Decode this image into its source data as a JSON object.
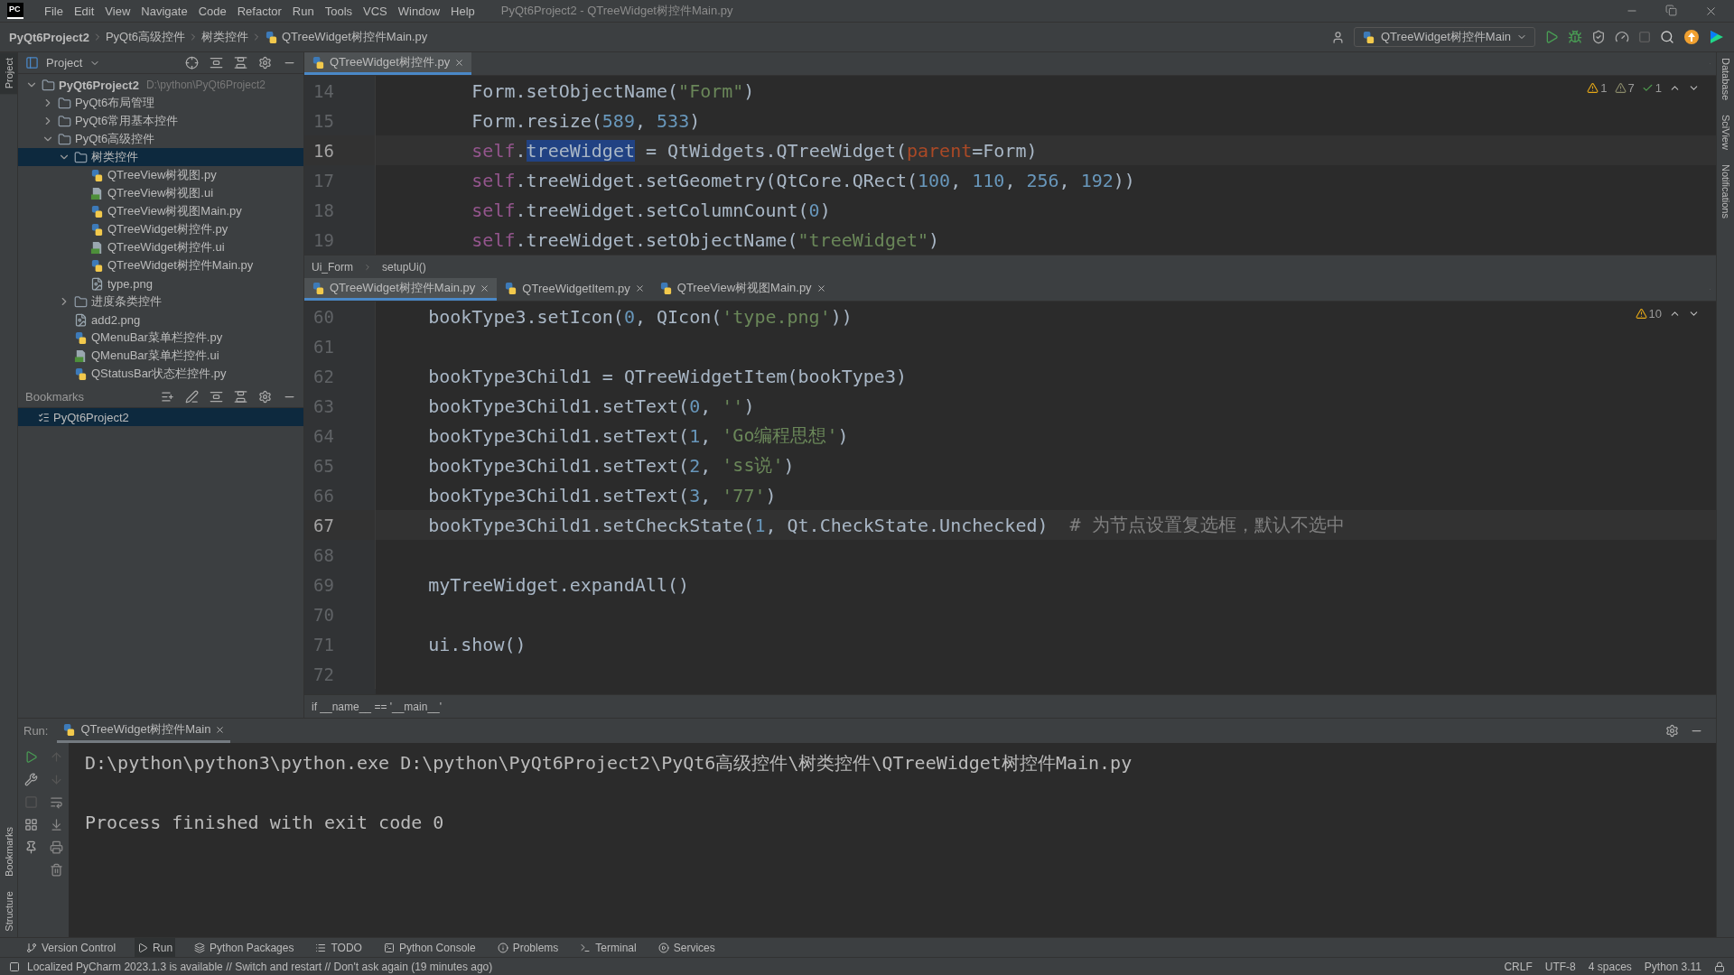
{
  "menu_bar": {
    "logo": "PC",
    "items": [
      "File",
      "Edit",
      "View",
      "Navigate",
      "Code",
      "Refactor",
      "Run",
      "Tools",
      "VCS",
      "Window",
      "Help"
    ],
    "title": "PyQt6Project2 - QTreeWidget树控件Main.py"
  },
  "nav_bar": {
    "breadcrumbs": [
      {
        "label": "PyQt6Project2",
        "kind": "project"
      },
      {
        "label": "PyQt6高级控件",
        "kind": "folder"
      },
      {
        "label": "树类控件",
        "kind": "folder"
      },
      {
        "label": "QTreeWidget树控件Main.py",
        "kind": "python"
      }
    ],
    "run_config": "QTreeWidget树控件Main"
  },
  "left_strip": {
    "top": [
      "Project"
    ],
    "bottom": [
      "Bookmarks",
      "Structure"
    ]
  },
  "right_strip": [
    "Database",
    "SciView",
    "Notifications"
  ],
  "project_panel": {
    "title": "Project",
    "tree": [
      {
        "label": "PyQt6Project2",
        "detail": "D:\\python\\PyQt6Project2",
        "kind": "folder",
        "expanded": true,
        "selected": false,
        "children": [
          {
            "label": "PyQt6布局管理",
            "kind": "folder",
            "expanded": false,
            "selected": false
          },
          {
            "label": "PyQt6常用基本控件",
            "kind": "folder",
            "expanded": false,
            "selected": false
          },
          {
            "label": "PyQt6高级控件",
            "kind": "folder",
            "expanded": true,
            "selected": false,
            "children": [
              {
                "label": "树类控件",
                "kind": "folder",
                "expanded": true,
                "selected": true,
                "children": [
                  {
                    "label": "QTreeView树视图.py",
                    "kind": "python",
                    "selected": false
                  },
                  {
                    "label": "QTreeView树视图.ui",
                    "kind": "ui",
                    "selected": false
                  },
                  {
                    "label": "QTreeView树视图Main.py",
                    "kind": "python",
                    "selected": false
                  },
                  {
                    "label": "QTreeWidget树控件.py",
                    "kind": "python",
                    "selected": false
                  },
                  {
                    "label": "QTreeWidget树控件.ui",
                    "kind": "ui",
                    "selected": false
                  },
                  {
                    "label": "QTreeWidget树控件Main.py",
                    "kind": "python",
                    "selected": false
                  },
                  {
                    "label": "type.png",
                    "kind": "image",
                    "selected": false
                  }
                ]
              },
              {
                "label": "进度条类控件",
                "kind": "folder",
                "expanded": false,
                "selected": false
              },
              {
                "label": "add2.png",
                "kind": "image",
                "selected": false
              },
              {
                "label": "QMenuBar菜单栏控件.py",
                "kind": "python",
                "selected": false
              },
              {
                "label": "QMenuBar菜单栏控件.ui",
                "kind": "ui",
                "selected": false
              },
              {
                "label": "QStatusBar状态栏控件.py",
                "kind": "python",
                "selected": false
              }
            ]
          }
        ]
      }
    ]
  },
  "bookmarks_panel": {
    "title": "Bookmarks",
    "items": [
      {
        "label": "PyQt6Project2",
        "selected": true
      }
    ]
  },
  "top_editor": {
    "tabs": [
      {
        "label": "QTreeWidget树控件.py",
        "selected": true
      }
    ],
    "inspections": [
      {
        "kind": "warning",
        "count": "1"
      },
      {
        "kind": "weak_warning",
        "count": "7"
      },
      {
        "kind": "typo",
        "count": "1"
      }
    ],
    "lines": [
      {
        "number": "14",
        "current": false,
        "tokens": [
          {
            "text": "        Form.setObjectName(",
            "kind": "plain"
          },
          {
            "text": "\"Form\"",
            "kind": "string"
          },
          {
            "text": ")",
            "kind": "plain"
          }
        ]
      },
      {
        "number": "15",
        "current": false,
        "tokens": [
          {
            "text": "        Form.resize(",
            "kind": "plain"
          },
          {
            "text": "589",
            "kind": "number"
          },
          {
            "text": ", ",
            "kind": "plain"
          },
          {
            "text": "533",
            "kind": "number"
          },
          {
            "text": ")",
            "kind": "plain"
          }
        ]
      },
      {
        "number": "16",
        "current": true,
        "tokens": [
          {
            "text": "        self",
            "kind": "self"
          },
          {
            "text": ".",
            "kind": "plain"
          },
          {
            "text": "treeWidget",
            "kind": "highlight"
          },
          {
            "text": " = QtWidgets.QTreeWidget(",
            "kind": "plain"
          },
          {
            "text": "parent",
            "kind": "param"
          },
          {
            "text": "=Form)",
            "kind": "plain"
          }
        ]
      },
      {
        "number": "17",
        "current": false,
        "tokens": [
          {
            "text": "        self",
            "kind": "self"
          },
          {
            "text": ".treeWidget.setGeometry(QtCore.QRect(",
            "kind": "plain"
          },
          {
            "text": "100",
            "kind": "number"
          },
          {
            "text": ", ",
            "kind": "plain"
          },
          {
            "text": "110",
            "kind": "number"
          },
          {
            "text": ", ",
            "kind": "plain"
          },
          {
            "text": "256",
            "kind": "number"
          },
          {
            "text": ", ",
            "kind": "plain"
          },
          {
            "text": "192",
            "kind": "number"
          },
          {
            "text": "))",
            "kind": "plain"
          }
        ]
      },
      {
        "number": "18",
        "current": false,
        "tokens": [
          {
            "text": "        self",
            "kind": "self"
          },
          {
            "text": ".treeWidget.setColumnCount(",
            "kind": "plain"
          },
          {
            "text": "0",
            "kind": "number"
          },
          {
            "text": ")",
            "kind": "plain"
          }
        ]
      },
      {
        "number": "19",
        "current": false,
        "tokens": [
          {
            "text": "        self",
            "kind": "self"
          },
          {
            "text": ".treeWidget.setObjectName(",
            "kind": "plain"
          },
          {
            "text": "\"treeWidget\"",
            "kind": "string"
          },
          {
            "text": ")",
            "kind": "plain"
          }
        ]
      }
    ],
    "breadcrumbs": [
      "Ui_Form",
      "setupUi()"
    ]
  },
  "bottom_editor": {
    "tabs": [
      {
        "label": "QTreeWidget树控件Main.py",
        "selected": true
      },
      {
        "label": "QTreeWidgetItem.py",
        "selected": false
      },
      {
        "label": "QTreeView树视图Main.py",
        "selected": false
      }
    ],
    "inspections": [
      {
        "kind": "warning",
        "count": "10"
      }
    ],
    "lines": [
      {
        "number": "60",
        "current": false,
        "tokens": [
          {
            "text": "    bookType3.setIcon(",
            "kind": "plain"
          },
          {
            "text": "0",
            "kind": "number"
          },
          {
            "text": ", QIcon(",
            "kind": "plain"
          },
          {
            "text": "'type.png'",
            "kind": "string"
          },
          {
            "text": "))",
            "kind": "plain"
          }
        ]
      },
      {
        "number": "61",
        "current": false
      },
      {
        "number": "62",
        "current": false,
        "tokens": [
          {
            "text": "    bookType3Child1 = QTreeWidgetItem(bookType3)",
            "kind": "plain"
          }
        ]
      },
      {
        "number": "63",
        "current": false,
        "tokens": [
          {
            "text": "    bookType3Child1.setText(",
            "kind": "plain"
          },
          {
            "text": "0",
            "kind": "number"
          },
          {
            "text": ", ",
            "kind": "plain"
          },
          {
            "text": "''",
            "kind": "string"
          },
          {
            "text": ")",
            "kind": "plain"
          }
        ]
      },
      {
        "number": "64",
        "current": false,
        "tokens": [
          {
            "text": "    bookType3Child1.setText(",
            "kind": "plain"
          },
          {
            "text": "1",
            "kind": "number"
          },
          {
            "text": ", ",
            "kind": "plain"
          },
          {
            "text": "'Go编程思想'",
            "kind": "string"
          },
          {
            "text": ")",
            "kind": "plain"
          }
        ]
      },
      {
        "number": "65",
        "current": false,
        "tokens": [
          {
            "text": "    bookType3Child1.setText(",
            "kind": "plain"
          },
          {
            "text": "2",
            "kind": "number"
          },
          {
            "text": ", ",
            "kind": "plain"
          },
          {
            "text": "'ss说'",
            "kind": "string"
          },
          {
            "text": ")",
            "kind": "plain"
          }
        ]
      },
      {
        "number": "66",
        "current": false,
        "tokens": [
          {
            "text": "    bookType3Child1.setText(",
            "kind": "plain"
          },
          {
            "text": "3",
            "kind": "number"
          },
          {
            "text": ", ",
            "kind": "plain"
          },
          {
            "text": "'77'",
            "kind": "string"
          },
          {
            "text": ")",
            "kind": "plain"
          }
        ]
      },
      {
        "number": "67",
        "current": true,
        "tokens": [
          {
            "text": "    bookType3Child1.setCheckState(",
            "kind": "plain"
          },
          {
            "text": "1",
            "kind": "number"
          },
          {
            "text": ", Qt.CheckState.Unchecked)  ",
            "kind": "plain"
          },
          {
            "text": "# 为节点设置复选框，默认不选中",
            "kind": "comment"
          }
        ]
      },
      {
        "number": "68",
        "current": false
      },
      {
        "number": "69",
        "current": false,
        "tokens": [
          {
            "text": "    myTreeWidget.expandAll()",
            "kind": "plain"
          }
        ]
      },
      {
        "number": "70",
        "current": false
      },
      {
        "number": "71",
        "current": false,
        "tokens": [
          {
            "text": "    ui.show()",
            "kind": "plain"
          }
        ]
      },
      {
        "number": "72",
        "current": false
      }
    ],
    "breadcrumbs": [
      "if __name__ == '__main__'"
    ]
  },
  "run_panel": {
    "label": "Run:",
    "tabs": [
      {
        "label": "QTreeWidget树控件Main",
        "selected": true
      }
    ],
    "output": [
      "D:\\python\\python3\\python.exe D:\\python\\PyQt6Project2\\PyQt6高级控件\\树类控件\\QTreeWidget树控件Main.py",
      "Process finished with exit code 0"
    ]
  },
  "tool_window_bar": [
    {
      "label": "Version Control",
      "kind": "vcs",
      "selected": false
    },
    {
      "label": "Run",
      "kind": "run",
      "selected": true
    },
    {
      "label": "Python Packages",
      "kind": "packages",
      "selected": false
    },
    {
      "label": "TODO",
      "kind": "todo",
      "selected": false
    },
    {
      "label": "Python Console",
      "kind": "console",
      "selected": false
    },
    {
      "label": "Problems",
      "kind": "problems",
      "selected": false
    },
    {
      "label": "Terminal",
      "kind": "terminal",
      "selected": false
    },
    {
      "label": "Services",
      "kind": "services",
      "selected": false
    }
  ],
  "status_bar": {
    "message": "Localized PyCharm 2023.1.3 is available // Switch and restart // Don't ask again (19 minutes ago)",
    "items": [
      "CRLF",
      "UTF-8",
      "4 spaces",
      "Python 3.11"
    ]
  }
}
